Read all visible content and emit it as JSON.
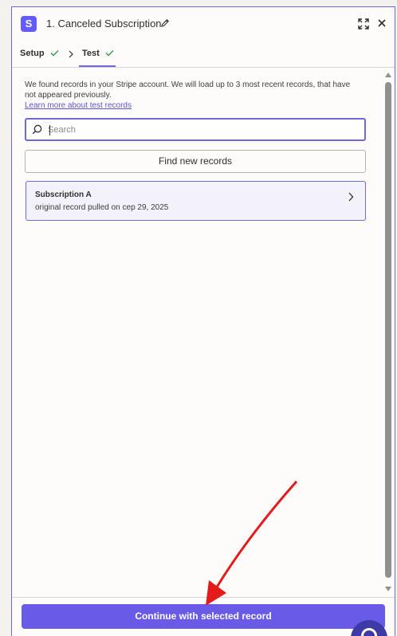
{
  "app": {
    "icon_letter": "S",
    "icon_color": "#635bff"
  },
  "header": {
    "title": "1. Canceled Subscription",
    "icons": [
      "pencil-icon",
      "expand-icon",
      "close-icon"
    ]
  },
  "tabs": [
    {
      "label": "Setup",
      "status": "check-icon",
      "active": false
    },
    {
      "label": "Test",
      "status": "check-icon",
      "active": true
    }
  ],
  "intro": {
    "text": "We found records in your Stripe account. We will load up to 3 most recent records, that have not appeared previously.",
    "link": "Learn more about test records"
  },
  "search": {
    "placeholder": "Search",
    "value": ""
  },
  "find_button": {
    "label": "Find new records"
  },
  "records": [
    {
      "title": "Subscription A",
      "subtitle": "original record pulled on cep 29, 2025"
    }
  ],
  "footer": {
    "continue_label": "Continue with selected record"
  },
  "colors": {
    "accent": "#6c6bd6",
    "primary_button": "#695be8",
    "check": "#2e9a48",
    "annotation_arrow": "#e31b1b"
  }
}
